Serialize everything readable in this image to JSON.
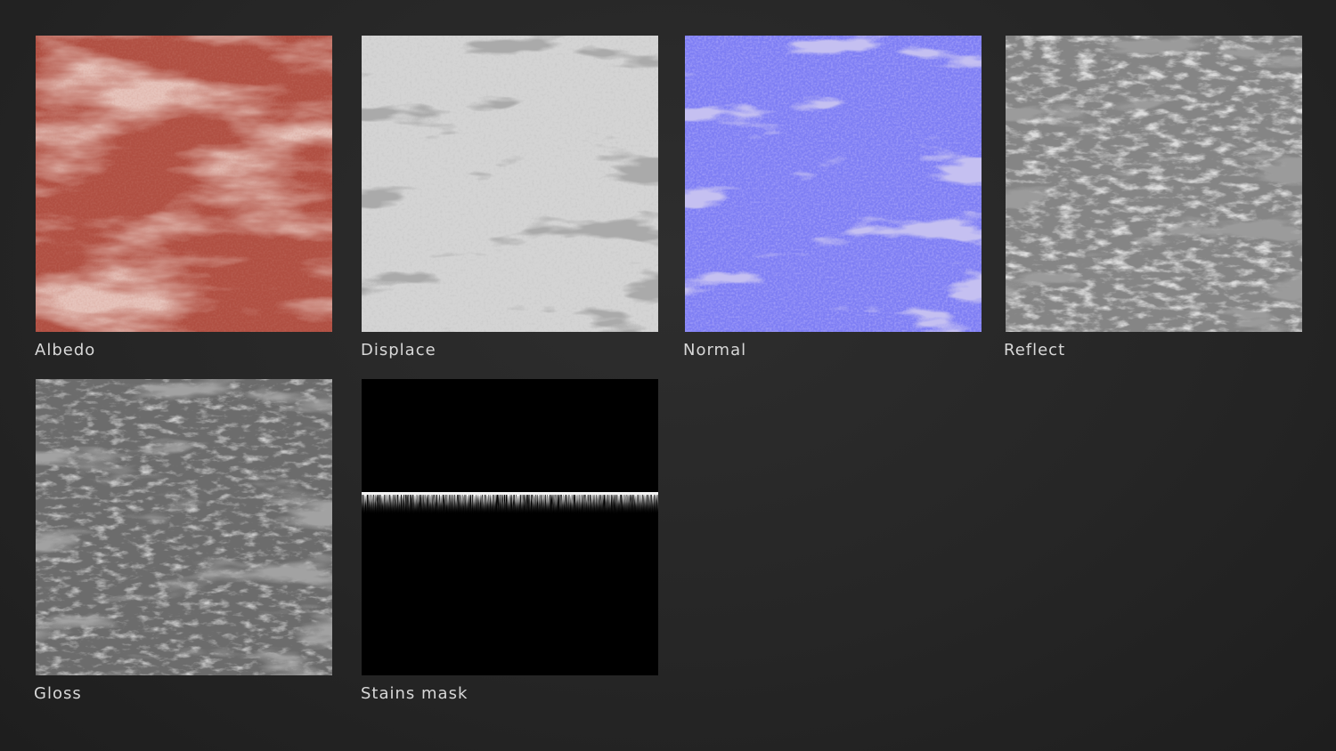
{
  "maps": [
    {
      "label": "Albedo",
      "base": "#b5574a",
      "light": "#c98a7e",
      "dark": "#9e4234"
    },
    {
      "label": "Displace",
      "base": "#cfcfcf",
      "light": "#e2e2e2",
      "dark": "#6a6a6a"
    },
    {
      "label": "Normal",
      "base": "#7f7ff2",
      "light": "#9a98ff",
      "dark": "#8a88d8"
    },
    {
      "label": "Reflect",
      "base": "#8a8a8a",
      "light": "#a6a6a6",
      "dark": "#525252"
    },
    {
      "label": "Gloss",
      "base": "#6f6f6f",
      "light": "#8f8f8f",
      "dark": "#5a5a5a"
    },
    {
      "label": "Stains mask",
      "base": "#000000",
      "light": "#ffffff",
      "dark": "#000000"
    }
  ]
}
